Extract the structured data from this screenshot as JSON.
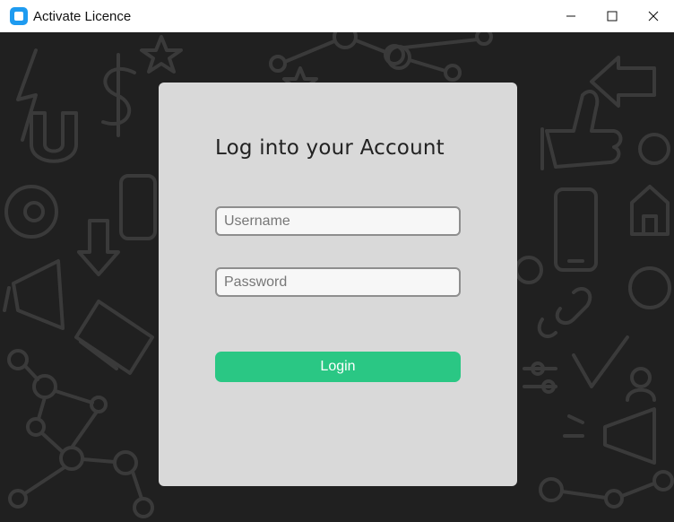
{
  "window": {
    "title": "Activate Licence",
    "icon": "app-icon",
    "controls": [
      "minimize-icon",
      "maximize-icon",
      "close-icon"
    ]
  },
  "login": {
    "heading": "Log into your Account",
    "username_placeholder": "Username",
    "username_value": "",
    "password_placeholder": "Password",
    "password_value": "",
    "button_label": "Login"
  },
  "colors": {
    "background": "#1f1f1f",
    "doodles": "#3a3a3a",
    "card": "#d9d9d9",
    "login_button": "#2ac784",
    "app_icon": "#1e9bf0"
  }
}
